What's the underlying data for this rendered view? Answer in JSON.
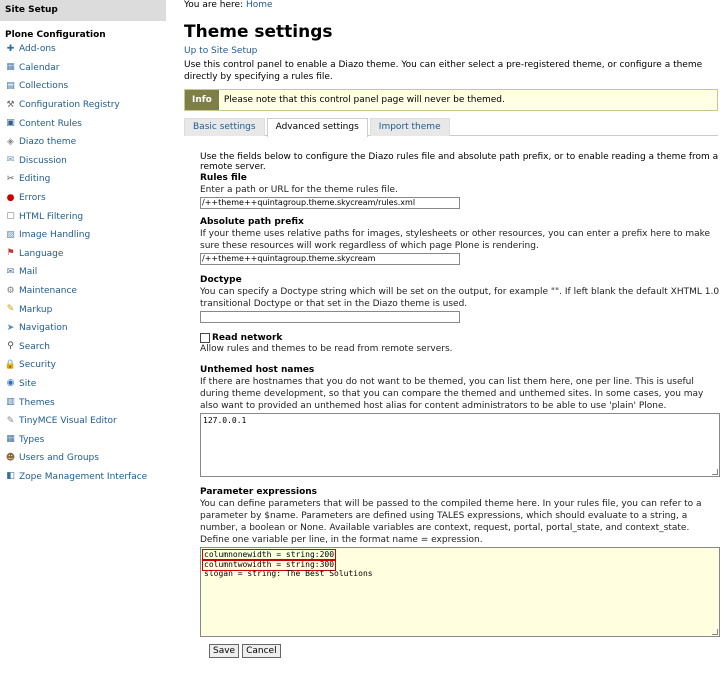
{
  "sidebar": {
    "header": "Site Setup",
    "section_title": "Plone Configuration",
    "items": [
      {
        "label": "Add-ons",
        "icon": "puzzle-icon",
        "color": "#2d6aa3"
      },
      {
        "label": "Calendar",
        "icon": "calendar-icon",
        "color": "#4a7ab0"
      },
      {
        "label": "Collections",
        "icon": "collections-icon",
        "color": "#3a6ea0"
      },
      {
        "label": "Configuration Registry",
        "icon": "wrench-icon",
        "color": "#666666"
      },
      {
        "label": "Content Rules",
        "icon": "content-rules-icon",
        "color": "#2f5f8f"
      },
      {
        "label": "Diazo theme",
        "icon": "diazo-icon",
        "color": "#888888"
      },
      {
        "label": "Discussion",
        "icon": "chat-icon",
        "color": "#6b8fb8"
      },
      {
        "label": "Editing",
        "icon": "scissors-icon",
        "color": "#555555"
      },
      {
        "label": "Errors",
        "icon": "error-icon",
        "color": "#cc0000"
      },
      {
        "label": "HTML Filtering",
        "icon": "html-filter-icon",
        "color": "#777777"
      },
      {
        "label": "Image Handling",
        "icon": "image-icon",
        "color": "#6688aa"
      },
      {
        "label": "Language",
        "icon": "flag-icon",
        "color": "#cc3333"
      },
      {
        "label": "Mail",
        "icon": "mail-icon",
        "color": "#4a6fa5"
      },
      {
        "label": "Maintenance",
        "icon": "maintenance-icon",
        "color": "#777777"
      },
      {
        "label": "Markup",
        "icon": "pencil-icon",
        "color": "#c9a000"
      },
      {
        "label": "Navigation",
        "icon": "navigation-icon",
        "color": "#4a90c0"
      },
      {
        "label": "Search",
        "icon": "search-icon",
        "color": "#444444"
      },
      {
        "label": "Security",
        "icon": "lock-icon",
        "color": "#c08a00"
      },
      {
        "label": "Site",
        "icon": "site-icon",
        "color": "#3070c0"
      },
      {
        "label": "Themes",
        "icon": "themes-icon",
        "color": "#3a6ea0"
      },
      {
        "label": "TinyMCE Visual Editor",
        "icon": "tinymce-icon",
        "color": "#888888"
      },
      {
        "label": "Types",
        "icon": "types-icon",
        "color": "#3a6ea0"
      },
      {
        "label": "Users and Groups",
        "icon": "users-icon",
        "color": "#8a6a3a"
      },
      {
        "label": "Zope Management Interface",
        "icon": "zmi-icon",
        "color": "#3a6ea0"
      }
    ]
  },
  "main": {
    "breadcrumb_prefix": "You are here:",
    "breadcrumb_link": "Home",
    "title": "Theme settings",
    "up_link": "Up to Site Setup",
    "description": "Use this control panel to enable a Diazo theme. You can either select a pre-registered theme, or configure a theme directly by specifying a rules file.",
    "info_label": "Info",
    "info_text": "Please note that this control panel page will never be themed.",
    "tabs": [
      {
        "label": "Basic settings",
        "active": false
      },
      {
        "label": "Advanced settings",
        "active": true
      },
      {
        "label": "Import theme",
        "active": false
      }
    ],
    "lead": "Use the fields below to configure the Diazo rules file and absolute path prefix, or to enable reading a theme from a remote server.",
    "rules_file": {
      "label": "Rules file",
      "help": "Enter a path or URL for the theme rules file.",
      "value": "/++theme++quintagroup.theme.skycream/rules.xml"
    },
    "path_prefix": {
      "label": "Absolute path prefix",
      "help": "If your theme uses relative paths for images, stylesheets or other resources, you can enter a prefix here to make sure these resources will work regardless of which page Plone is rendering.",
      "value": "/++theme++quintagroup.theme.skycream"
    },
    "doctype": {
      "label": "Doctype",
      "help": "You can specify a Doctype string which will be set on the output, for example \"\". If left blank the default XHTML 1.0 transitional Doctype or that set in the Diazo theme is used.",
      "value": ""
    },
    "read_network": {
      "label": "Read network",
      "help": "Allow rules and themes to be read from remote servers.",
      "checked": false
    },
    "unthemed_hosts": {
      "label": "Unthemed host names",
      "help": "If there are hostnames that you do not want to be themed, you can list them here, one per line. This is useful during theme development, so that you can compare the themed and unthemed sites. In some cases, you may also want to provided an unthemed host alias for content administrators to be able to use 'plain' Plone.",
      "value": "127.0.0.1"
    },
    "parameters": {
      "label": "Parameter expressions",
      "help": "You can define parameters that will be passed to the compiled theme here. In your rules file, you can refer to a parameter by $name. Parameters are defined using TALES expressions, which should evaluate to a string, a number, a boolean or None. Available variables are context, request, portal, portal_state, and context_state. Define one variable per line, in the format name = expression.",
      "lines": [
        "columnonewidth = string:200",
        "columntwowidth = string:300",
        "slogan = string: The Best Solutions"
      ]
    },
    "save_label": "Save",
    "cancel_label": "Cancel"
  }
}
